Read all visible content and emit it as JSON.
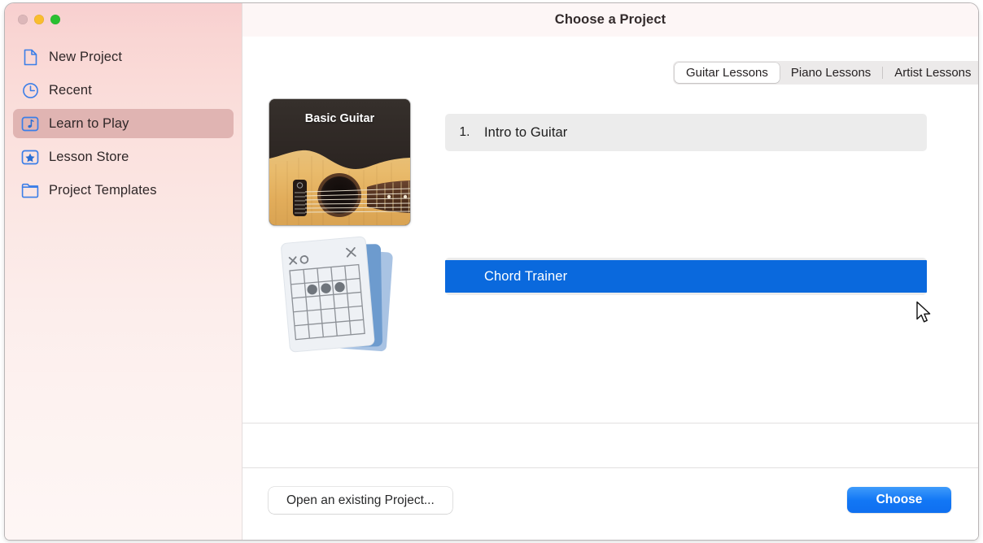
{
  "window": {
    "title": "Choose a Project",
    "traffic_lights": [
      {
        "name": "close",
        "color": "#dcb7b9"
      },
      {
        "name": "minimize",
        "color": "#f9bd2e"
      },
      {
        "name": "zoom",
        "color": "#2ac031"
      }
    ]
  },
  "sidebar": {
    "items": [
      {
        "label": "New Project",
        "icon": "document-icon",
        "selected": false
      },
      {
        "label": "Recent",
        "icon": "clock-icon",
        "selected": false
      },
      {
        "label": "Learn to Play",
        "icon": "music-note-icon",
        "selected": true
      },
      {
        "label": "Lesson Store",
        "icon": "star-icon",
        "selected": false
      },
      {
        "label": "Project Templates",
        "icon": "folder-icon",
        "selected": false
      }
    ],
    "selected_color": "#e0b4b2",
    "icon_color": "#3b7ee8"
  },
  "tabs": {
    "selected": "Guitar Lessons",
    "items": [
      {
        "label": "Guitar Lessons",
        "active": true
      },
      {
        "label": "Piano Lessons",
        "active": false
      },
      {
        "label": "Artist Lessons",
        "active": false
      }
    ]
  },
  "lessons": [
    {
      "thumbnail_title": "Basic Guitar",
      "thumbnail_kind": "guitar-photo",
      "number": "1.",
      "title": "Intro to Guitar",
      "selected": false
    },
    {
      "thumbnail_title": "",
      "thumbnail_kind": "chord-cards",
      "number": "",
      "title": "Chord Trainer",
      "selected": true
    }
  ],
  "footer": {
    "open_existing_label": "Open an existing Project...",
    "choose_label": "Choose",
    "choose_color": "#0f6ff0"
  },
  "colors": {
    "selection_blue": "#0a69dd",
    "row_gray": "#ececec",
    "sidebar_top": "#f8cfcf",
    "sidebar_bottom": "#fef6f5"
  }
}
